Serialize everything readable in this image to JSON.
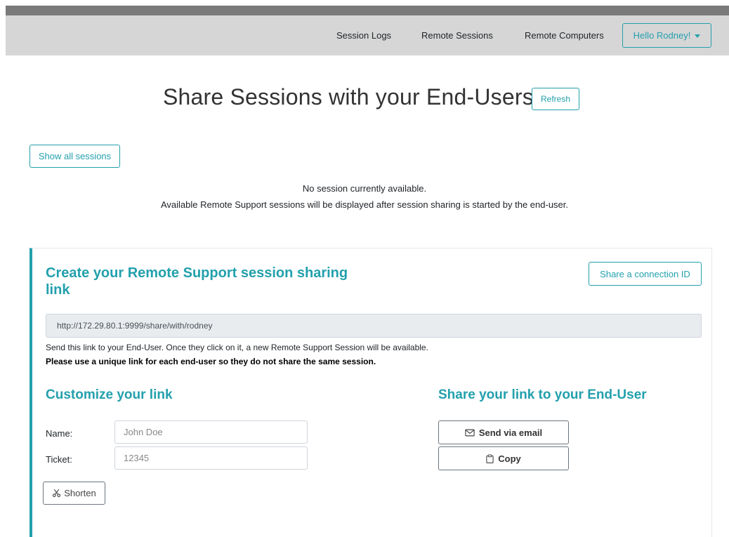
{
  "navbar": {
    "links": [
      {
        "label": "Session Logs"
      },
      {
        "label": "Remote Sessions"
      },
      {
        "label": "Remote Computers"
      }
    ],
    "user_menu": {
      "label": "Hello Rodney!"
    }
  },
  "header": {
    "title": "Share Sessions with your End-Users",
    "refresh_label": "Refresh"
  },
  "sessions": {
    "show_all_label": "Show all sessions",
    "empty_line1": "No session currently available.",
    "empty_line2": "Available Remote Support sessions will be displayed after session sharing is started by the end-user."
  },
  "link_card": {
    "title": "Create your Remote Support session sharing link",
    "share_id_label": "Share a connection ID",
    "link_url": "http://172.29.80.1:9999/share/with/rodney",
    "help_text": "Send this link to your End-User. Once they click on it, a new Remote Support Session will be available.",
    "warning_text": "Please use a unique link for each end-user so they do not share the same session.",
    "customize": {
      "title": "Customize your link",
      "name_label": "Name:",
      "name_placeholder": "John Doe",
      "ticket_label": "Ticket:",
      "ticket_placeholder": "12345",
      "shorten_label": "Shorten"
    },
    "share": {
      "title": "Share your link to your End-User",
      "email_label": "Send via email",
      "copy_label": "Copy"
    }
  },
  "colors": {
    "accent": "#23a0ad",
    "navbar_bg": "#d6d6d6"
  },
  "icons": {
    "caret": "caret-down-icon",
    "email": "envelope-icon",
    "copy": "clipboard-icon",
    "shorten": "scissors-icon"
  }
}
